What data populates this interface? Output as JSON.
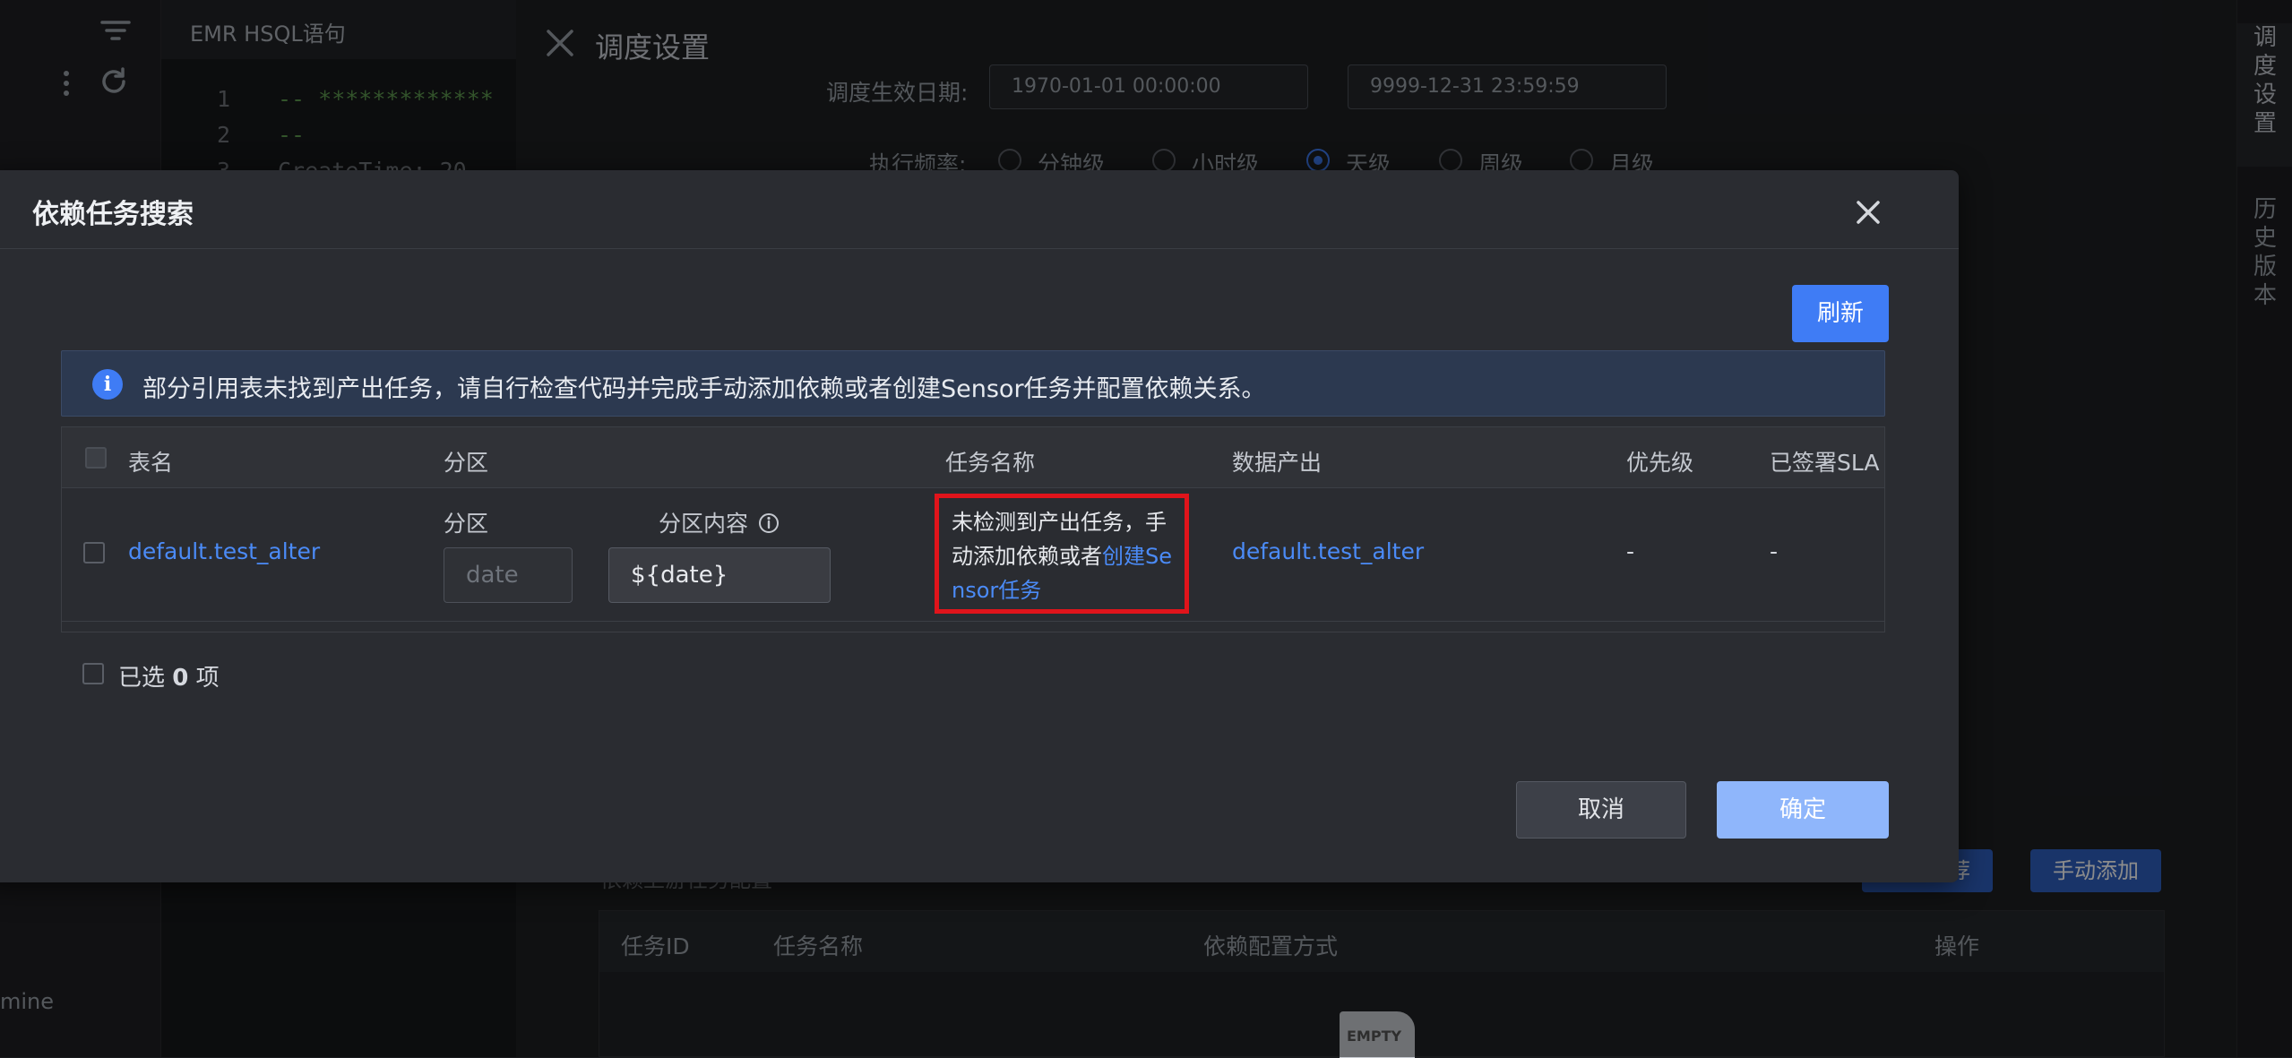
{
  "editor": {
    "tab_title": "EMR HSQL语句",
    "line_numbers": [
      "1",
      "2",
      "3"
    ],
    "code_lines": [
      "-- *************",
      "--",
      "  CreateTime: 20"
    ]
  },
  "left_panel": {
    "footer_text": "mine"
  },
  "drawer": {
    "title": "调度设置",
    "effective_date_label": "调度生效日期:",
    "date_start": "1970-01-01 00:00:00",
    "date_end": "9999-12-31 23:59:59",
    "frequency_label": "执行频率:",
    "frequency_options": [
      "分钟级",
      "小时级",
      "天级",
      "周级",
      "月级"
    ],
    "frequency_selected": "天级",
    "deps_label": "依赖上游任务配置",
    "recommend_button": "自动推荐",
    "manual_add_button": "手动添加",
    "dep_table_headers": [
      "任务ID",
      "任务名称",
      "依赖配置方式",
      "操作"
    ],
    "empty_text": "EMPTY"
  },
  "right_rail": {
    "tabs": [
      "调度设置",
      "历史版本"
    ]
  },
  "modal": {
    "title": "依赖任务搜索",
    "refresh_button": "刷新",
    "alert_text": "部分引用表未找到产出任务，请自行检查代码并完成手动添加依赖或者创建Sensor任务并配置依赖关系。",
    "table": {
      "headers": {
        "table_name": "表名",
        "partition": "分区",
        "task_name": "任务名称",
        "data_output": "数据产出",
        "priority": "优先级",
        "sla": "已签署SLA"
      },
      "rows": [
        {
          "table_name": "default.test_alter",
          "partition_label": "分区",
          "partition_content_label": "分区内容",
          "partition_placeholder": "date",
          "partition_content_value": "${date}",
          "task_name_text": "未检测到产出任务，手动添加依赖或者",
          "task_name_link": "创建Sensor任务",
          "data_output": "default.test_alter",
          "priority": "-",
          "sla": "-"
        }
      ]
    },
    "selected_prefix": "已选",
    "selected_count": "0",
    "selected_suffix": "项",
    "cancel_button": "取消",
    "confirm_button": "确定"
  },
  "colors": {
    "primary": "#3f7cf5",
    "link": "#4b8bf7",
    "highlight_border": "#e0141b",
    "modal_bg": "#2a2c31",
    "alert_bg": "#2c3950"
  }
}
